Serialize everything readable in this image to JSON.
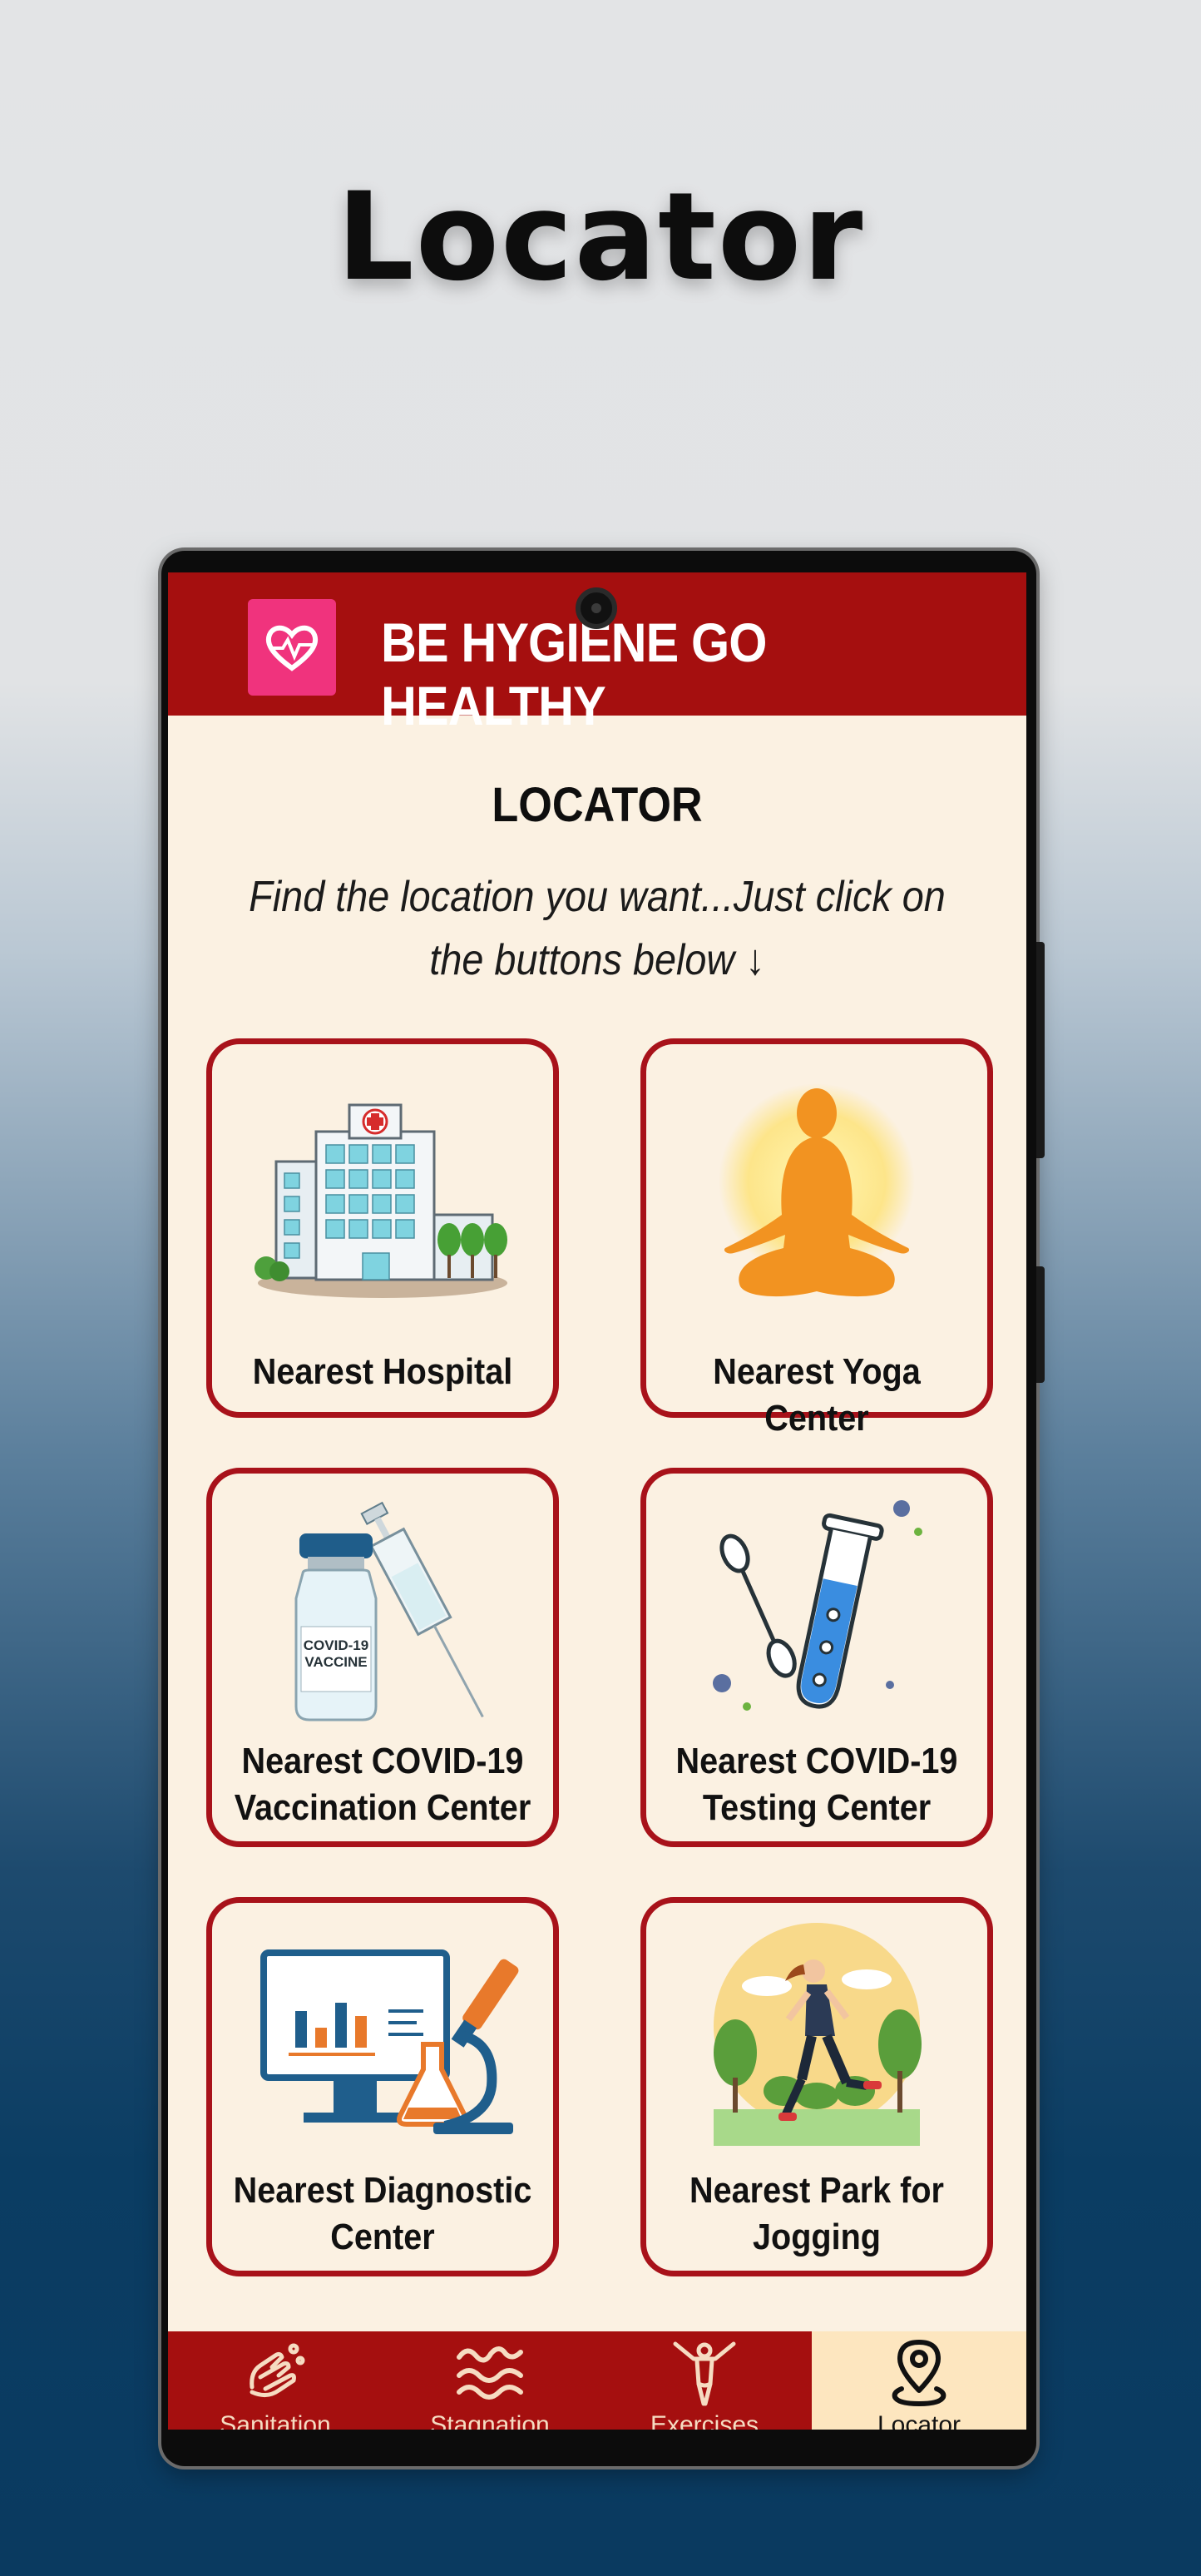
{
  "promo": {
    "title": "Locator"
  },
  "app": {
    "title": "BE HYGIENE GO HEALTHY",
    "logo_icon": "heart-pulse-icon"
  },
  "page": {
    "heading": "LOCATOR",
    "subtitle": "Find the location you want...Just click on the buttons below ↓"
  },
  "cards": [
    {
      "line1": "Nearest Hospital",
      "line2": "",
      "icon": "hospital-icon"
    },
    {
      "line1": "Nearest Yoga Center",
      "line2": "",
      "icon": "yoga-icon"
    },
    {
      "line1": "Nearest COVID-19",
      "line2": "Vaccination Center",
      "icon": "vaccine-icon",
      "vial_text1": "COVID-19",
      "vial_text2": "VACCINE"
    },
    {
      "line1": "Nearest COVID-19",
      "line2": "Testing Center",
      "icon": "test-tube-icon"
    },
    {
      "line1": "Nearest Diagnostic",
      "line2": "Center",
      "icon": "diagnostic-icon"
    },
    {
      "line1": "Nearest Park for",
      "line2": "Jogging",
      "icon": "jogging-icon"
    }
  ],
  "nav": {
    "items": [
      {
        "label": "Sanitation",
        "icon": "hand-wash-icon",
        "active": false
      },
      {
        "label": "Stagnation",
        "icon": "water-waves-icon",
        "active": false
      },
      {
        "label": "Exercises",
        "icon": "stretch-figure-icon",
        "active": false
      },
      {
        "label": "Locator",
        "icon": "map-pin-icon",
        "active": true
      }
    ]
  },
  "colors": {
    "primary": "#a50f0f",
    "background": "#fbf1e2",
    "logo": "#f0337d",
    "active_tab": "#fde6bf"
  }
}
